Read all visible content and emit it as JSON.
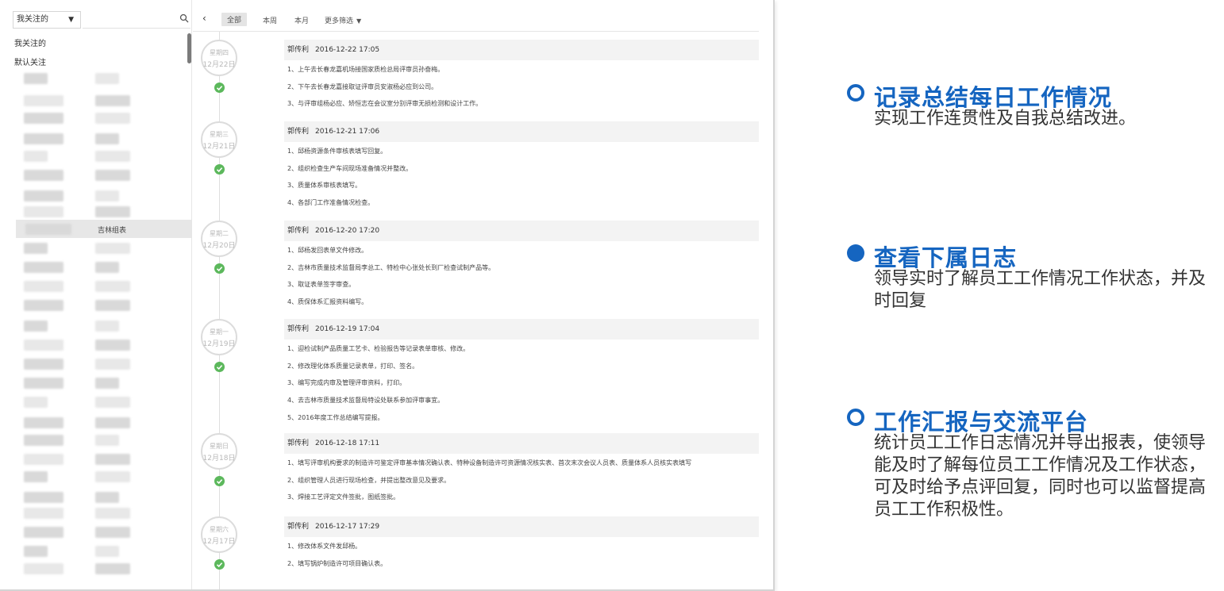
{
  "sidebar": {
    "filter_value": "我关注的",
    "links": [
      "我关注的",
      "默认关注"
    ],
    "selected_item": "吉林组表"
  },
  "toolbar": {
    "tabs": [
      "全部",
      "本周",
      "本月"
    ],
    "more_label": "更多筛选"
  },
  "entries": [
    {
      "weekday": "星期四",
      "date": "12月22日",
      "author": "郭传利",
      "time": "2016-12-22 17:05",
      "lines": [
        "1、上午去长春龙嘉机场接国家质检总局评审员孙奋梅。",
        "2、下午去长春龙嘉接取证评审员安淑杨必应到公司。",
        "3、与评审组杨必应、矫恒志在会议室分别评审无损检测和设计工作。"
      ]
    },
    {
      "weekday": "星期三",
      "date": "12月21日",
      "author": "郭传利",
      "time": "2016-12-21 17:06",
      "lines": [
        "1、邱杨资源条件审核表填写回复。",
        "2、组织检查生产车间现场准备情况并整改。",
        "3、质量体系审核表填写。",
        "4、各部门工作准备情况检查。"
      ]
    },
    {
      "weekday": "星期二",
      "date": "12月20日",
      "author": "郭传利",
      "time": "2016-12-20 17:20",
      "lines": [
        "1、邱杨发回表单文件修改。",
        "2、吉林市质量技术监督局李总工、特检中心张处长到厂检查试制产品等。",
        "3、取证表单签字审查。",
        "4、质保体系汇报资料编写。"
      ]
    },
    {
      "weekday": "星期一",
      "date": "12月19日",
      "author": "郭传利",
      "time": "2016-12-19 17:04",
      "lines": [
        "1、迎检试制产品质量工艺卡、检验报告等记录表单审核、修改。",
        "2、修改理化体系质量记录表单，打印、签名。",
        "3、编写完成内审及管理评审资料，打印。",
        "4、去吉林市质量技术监督局特设处联系参加评审事宜。",
        "5、2016年度工作总结编写提报。"
      ]
    },
    {
      "weekday": "星期日",
      "date": "12月18日",
      "author": "郭传利",
      "time": "2016-12-18 17:11",
      "lines": [
        "1、填写评审机构要求的制造许可鉴定评审基本情况确认表、特种设备制造许可资源情况核实表、首次末次会议人员表、质量体系人员核实表填写",
        "2、组织管理人员进行现场检查，并提出整改意见及要求。",
        "3、焊接工艺评定文件签批，图纸签批。"
      ]
    },
    {
      "weekday": "星期六",
      "date": "12月17日",
      "author": "郭传利",
      "time": "2016-12-17 17:29",
      "lines": [
        "1、修改体系文件发邱杨。",
        "2、填写锅炉制造许可项目确认表。"
      ]
    }
  ],
  "features": [
    {
      "title": "记录总结每日工作情况",
      "desc": "实现工作连贯性及自我总结改进。",
      "bullet": "ring"
    },
    {
      "title": "查看下属日志",
      "desc": "领导实时了解员工工作情况工作状态，并及时回复",
      "bullet": "fill"
    },
    {
      "title": "工作汇报与交流平台",
      "desc": "统计员工工作日志情况并导出报表，使领导能及时了解每位员工工作情况及工作状态，可及时给予点评回复，同时也可以监督提高员工工作积极性。",
      "bullet": "ring"
    }
  ],
  "colors": {
    "accent": "#1565c0",
    "check": "#5cb85c"
  }
}
